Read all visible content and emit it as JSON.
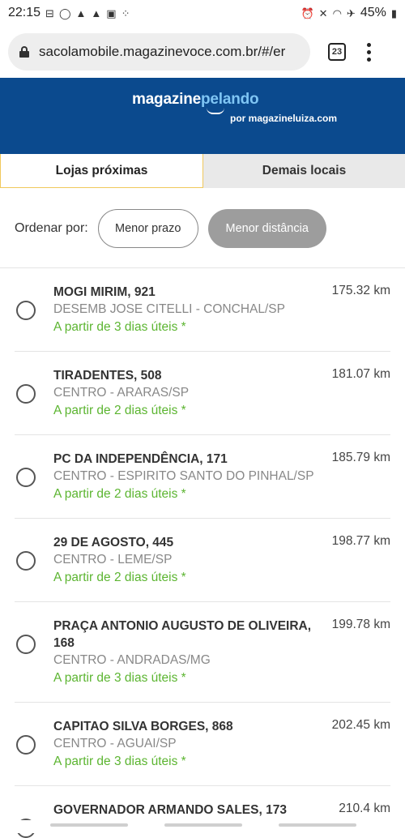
{
  "status": {
    "time": "22:15",
    "battery": "45%"
  },
  "browser": {
    "url": "sacolamobile.magazinevoce.com.br/#/er",
    "tab_count": "23"
  },
  "header": {
    "logo_magazine": "magazine",
    "logo_pelando": "pelando",
    "logo_sub": "por magazineluiza.com"
  },
  "tabs": [
    {
      "label": "Lojas próximas",
      "active": true
    },
    {
      "label": "Demais locais",
      "active": false
    }
  ],
  "sort": {
    "label": "Ordenar por:",
    "options": [
      "Menor prazo",
      "Menor distância"
    ],
    "selected": "Menor distância"
  },
  "stores": [
    {
      "name": "MOGI MIRIM, 921",
      "address": "DESEMB JOSE CITELLI - CONCHAL/SP",
      "delivery": "A partir de 3 dias úteis *",
      "distance": "175.32 km"
    },
    {
      "name": "TIRADENTES, 508",
      "address": "CENTRO - ARARAS/SP",
      "delivery": "A partir de 2 dias úteis *",
      "distance": "181.07 km"
    },
    {
      "name": "PC DA INDEPENDÊNCIA, 171",
      "address": "CENTRO - ESPIRITO SANTO DO PINHAL/SP",
      "delivery": "A partir de 2 dias úteis *",
      "distance": "185.79 km"
    },
    {
      "name": "29 DE AGOSTO, 445",
      "address": "CENTRO - LEME/SP",
      "delivery": "A partir de 2 dias úteis *",
      "distance": "198.77 km"
    },
    {
      "name": "PRAÇA ANTONIO AUGUSTO DE OLIVEIRA, 168",
      "address": "CENTRO - ANDRADAS/MG",
      "delivery": "A partir de 3 dias úteis *",
      "distance": "199.78 km"
    },
    {
      "name": "CAPITAO SILVA BORGES, 868",
      "address": "CENTRO - AGUAI/SP",
      "delivery": "A partir de 3 dias úteis *",
      "distance": "202.45 km"
    },
    {
      "name": "GOVERNADOR ARMANDO SALES, 173",
      "address": "",
      "delivery": "",
      "distance": "210.4 km"
    }
  ],
  "colors": {
    "header_bg": "#0b4a8e",
    "delivery_text": "#5cb531",
    "tab_active_border": "#f0c85c"
  }
}
